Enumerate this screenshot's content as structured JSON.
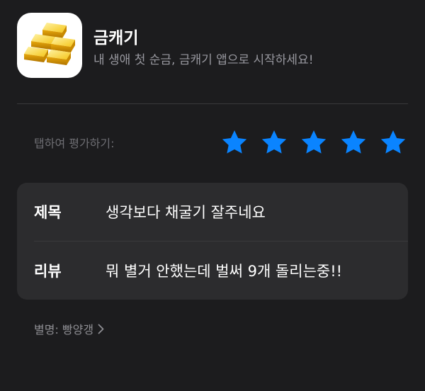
{
  "app": {
    "name": "금캐기",
    "subtitle": "내 생애 첫 순금, 금캐기 앱으로 시작하세요!",
    "icon": "gold-bars-icon"
  },
  "rating": {
    "label": "탭하여 평가하기:",
    "value": 5,
    "max": 5,
    "star_color": "#0a84ff"
  },
  "review_form": {
    "title_label": "제목",
    "title_value": "생각보다 채굴기 잘주네요",
    "review_label": "리뷰",
    "review_value": "뭐 별거 안했는데 벌써 9개 돌리는중!!"
  },
  "nickname": {
    "text": "별명: 빵양갱",
    "icon": "chevron-right-icon"
  },
  "colors": {
    "background": "#1c1c1e",
    "card": "#2c2c2e",
    "secondary_text": "#98989f",
    "accent": "#0a84ff"
  }
}
